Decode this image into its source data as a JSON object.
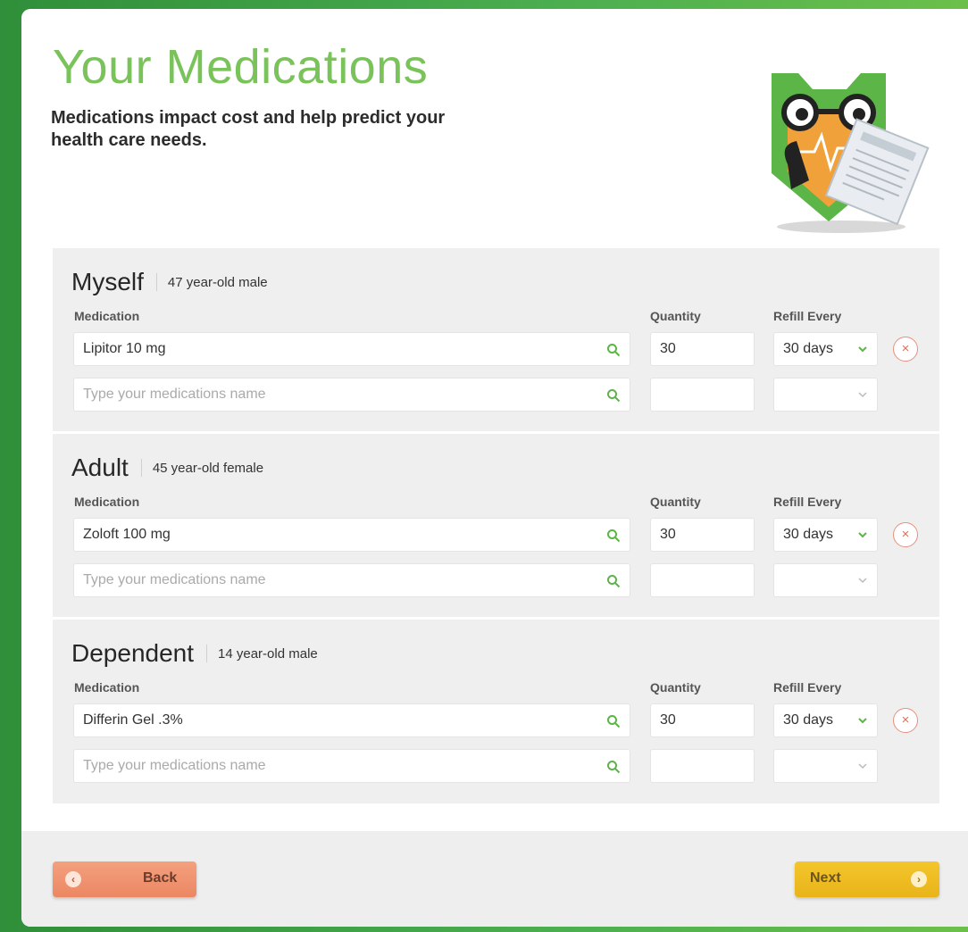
{
  "page": {
    "title": "Your Medications",
    "subtitle": "Medications impact cost and help predict your health care needs."
  },
  "labels": {
    "medication": "Medication",
    "quantity": "Quantity",
    "refill": "Refill Every",
    "placeholder": "Type your medications name",
    "remove_symbol": "×"
  },
  "sections": [
    {
      "name": "Myself",
      "desc": "47 year-old male",
      "medication": "Lipitor 10 mg",
      "quantity": "30",
      "refill": "30 days"
    },
    {
      "name": "Adult",
      "desc": "45 year-old female",
      "medication": "Zoloft 100 mg",
      "quantity": "30",
      "refill": "30 days"
    },
    {
      "name": "Dependent",
      "desc": "14 year-old male",
      "medication": "Differin Gel .3%",
      "quantity": "30",
      "refill": "30 days"
    }
  ],
  "footer": {
    "back_label": "Back",
    "next_label": "Next",
    "back_icon": "‹",
    "next_icon": "›"
  },
  "colors": {
    "accent_green": "#79c35a",
    "back_button": "#ec8763",
    "next_button": "#e8b41a",
    "remove_red": "#e06f5a"
  }
}
